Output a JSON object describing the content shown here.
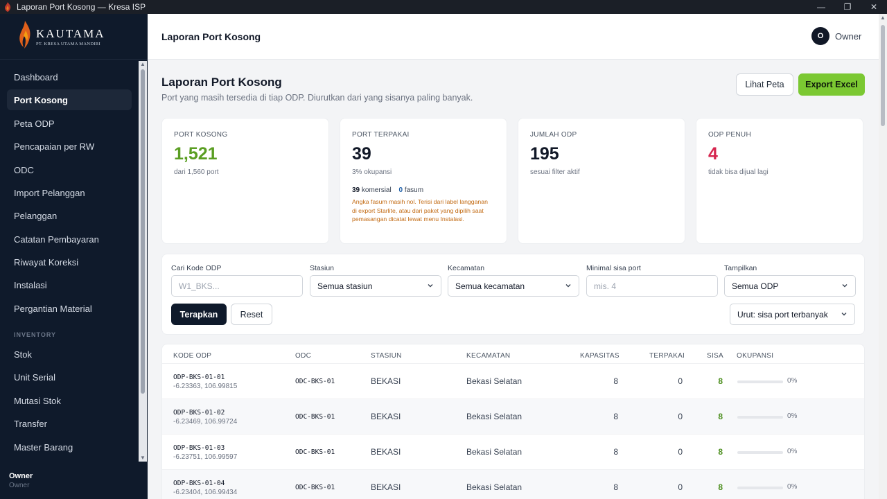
{
  "window": {
    "title": "Laporan Port Kosong — Kresa ISP",
    "controls": {
      "minimize": "—",
      "maximize": "❐",
      "close": "✕"
    }
  },
  "sidebar": {
    "logo": {
      "name": "KAUTAMA",
      "tagline": "PT. KRESA UTAMA MANDIRI"
    },
    "items": [
      {
        "label": "Dashboard"
      },
      {
        "label": "Port Kosong",
        "active": true
      },
      {
        "label": "Peta ODP"
      },
      {
        "label": "Pencapaian per RW"
      },
      {
        "label": "ODC"
      },
      {
        "label": "Import Pelanggan"
      },
      {
        "label": "Pelanggan"
      },
      {
        "label": "Catatan Pembayaran"
      },
      {
        "label": "Riwayat Koreksi"
      },
      {
        "label": "Instalasi"
      },
      {
        "label": "Pergantian Material"
      }
    ],
    "inventory_section": "INVENTORY",
    "inventory_items": [
      {
        "label": "Stok"
      },
      {
        "label": "Unit Serial"
      },
      {
        "label": "Mutasi Stok"
      },
      {
        "label": "Transfer"
      },
      {
        "label": "Master Barang"
      }
    ],
    "user": {
      "name": "Owner",
      "role": "Owner"
    }
  },
  "header": {
    "title": "Laporan Port Kosong",
    "avatar_initial": "O",
    "user_name": "Owner"
  },
  "page": {
    "title": "Laporan Port Kosong",
    "subtitle": "Port yang masih tersedia di tiap ODP. Diurutkan dari yang sisanya paling banyak.",
    "btn_map": "Lihat Peta",
    "btn_export": "Export Excel"
  },
  "cards": [
    {
      "label": "PORT KOSONG",
      "value": "1,521",
      "sub": "dari 1,560 port",
      "color": "#5a9e22"
    },
    {
      "label": "PORT TERPAKAI",
      "value": "39",
      "sub": "3% okupansi",
      "color": "#111827",
      "komersial_count": "39",
      "komersial_label": "komersial",
      "fasum_count": "0",
      "fasum_label": "fasum",
      "note": "Angka fasum masih nol. Terisi dari label langganan di export Starlite, atau dari paket yang dipilih saat pemasangan dicatat lewat menu Instalasi."
    },
    {
      "label": "JUMLAH ODP",
      "value": "195",
      "sub": "sesuai filter aktif",
      "color": "#111827"
    },
    {
      "label": "ODP PENUH",
      "value": "4",
      "sub": "tidak bisa dijual lagi",
      "color": "#d6264f"
    }
  ],
  "filters": {
    "kode": {
      "label": "Cari Kode ODP",
      "placeholder": "W1_BKS..."
    },
    "stasiun": {
      "label": "Stasiun",
      "value": "Semua stasiun"
    },
    "kecamatan": {
      "label": "Kecamatan",
      "value": "Semua kecamatan"
    },
    "minimal": {
      "label": "Minimal sisa port",
      "placeholder": "mis. 4"
    },
    "tampilkan": {
      "label": "Tampilkan",
      "value": "Semua ODP"
    },
    "apply": "Terapkan",
    "reset": "Reset",
    "sort": "Urut: sisa port terbanyak"
  },
  "table": {
    "headers": [
      "KODE ODP",
      "ODC",
      "STASIUN",
      "KECAMATAN",
      "KAPASITAS",
      "TERPAKAI",
      "SISA",
      "OKUPANSI"
    ],
    "rows": [
      {
        "kode": "ODP-BKS-01-01",
        "coord": "-6.23363, 106.99815",
        "odc": "ODC-BKS-01",
        "stasiun": "BEKASI",
        "kecamatan": "Bekasi Selatan",
        "kapasitas": "8",
        "terpakai": "0",
        "sisa": "8",
        "okupansi": "0%",
        "okupansi_value": 0
      },
      {
        "kode": "ODP-BKS-01-02",
        "coord": "-6.23469, 106.99724",
        "odc": "ODC-BKS-01",
        "stasiun": "BEKASI",
        "kecamatan": "Bekasi Selatan",
        "kapasitas": "8",
        "terpakai": "0",
        "sisa": "8",
        "okupansi": "0%",
        "okupansi_value": 0
      },
      {
        "kode": "ODP-BKS-01-03",
        "coord": "-6.23751, 106.99597",
        "odc": "ODC-BKS-01",
        "stasiun": "BEKASI",
        "kecamatan": "Bekasi Selatan",
        "kapasitas": "8",
        "terpakai": "0",
        "sisa": "8",
        "okupansi": "0%",
        "okupansi_value": 0
      },
      {
        "kode": "ODP-BKS-01-04",
        "coord": "-6.23404, 106.99434",
        "odc": "ODC-BKS-01",
        "stasiun": "BEKASI",
        "kecamatan": "Bekasi Selatan",
        "kapasitas": "8",
        "terpakai": "0",
        "sisa": "8",
        "okupansi": "0%",
        "okupansi_value": 0
      }
    ]
  }
}
